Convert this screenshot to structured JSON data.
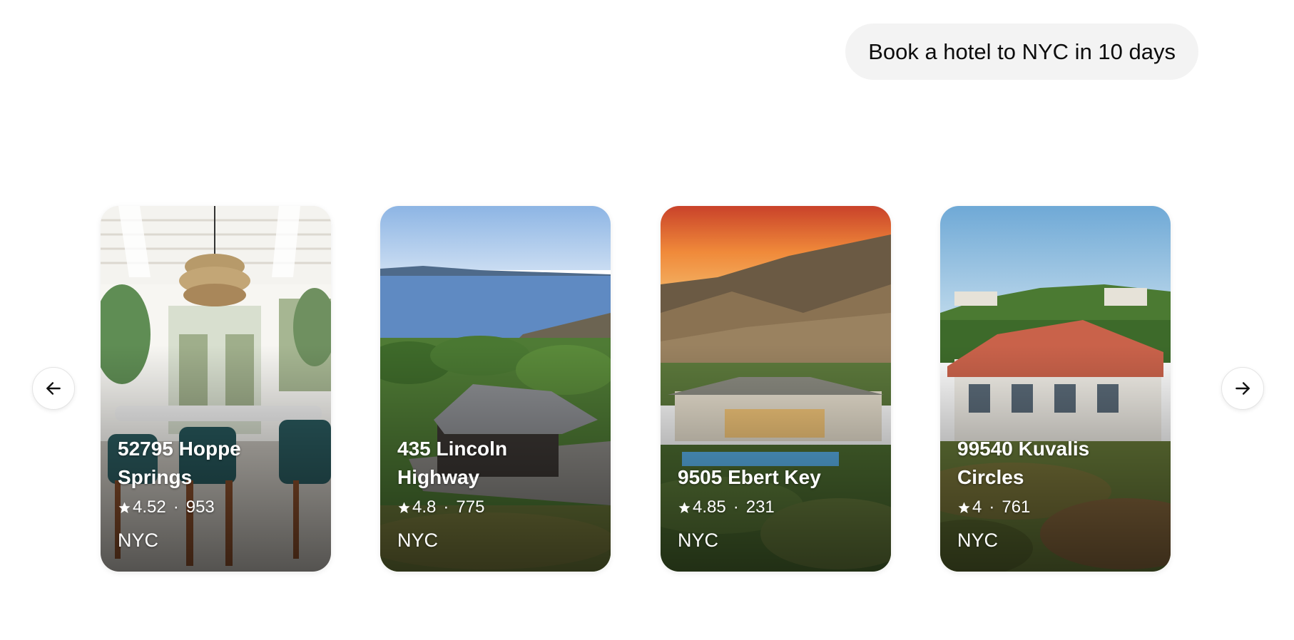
{
  "chat": {
    "message": "Book a hotel to NYC in 10 days"
  },
  "carousel": {
    "prev_icon": "arrow-left-icon",
    "next_icon": "arrow-right-icon",
    "cards": [
      {
        "title": "52795 Hoppe Springs",
        "rating": "4.52",
        "reviews": "953",
        "city": "NYC",
        "image": "dining-room-interior"
      },
      {
        "title": "435 Lincoln Highway",
        "rating": "4.8",
        "reviews": "775",
        "city": "NYC",
        "image": "cabin-by-lake"
      },
      {
        "title": "9505 Ebert Key",
        "rating": "4.85",
        "reviews": "231",
        "city": "NYC",
        "image": "villa-sunset-hills"
      },
      {
        "title": "99540 Kuvalis Circles",
        "rating": "4",
        "reviews": "761",
        "city": "NYC",
        "image": "mansion-with-garden"
      }
    ],
    "separator": "·",
    "rating_icon": "star-icon"
  }
}
